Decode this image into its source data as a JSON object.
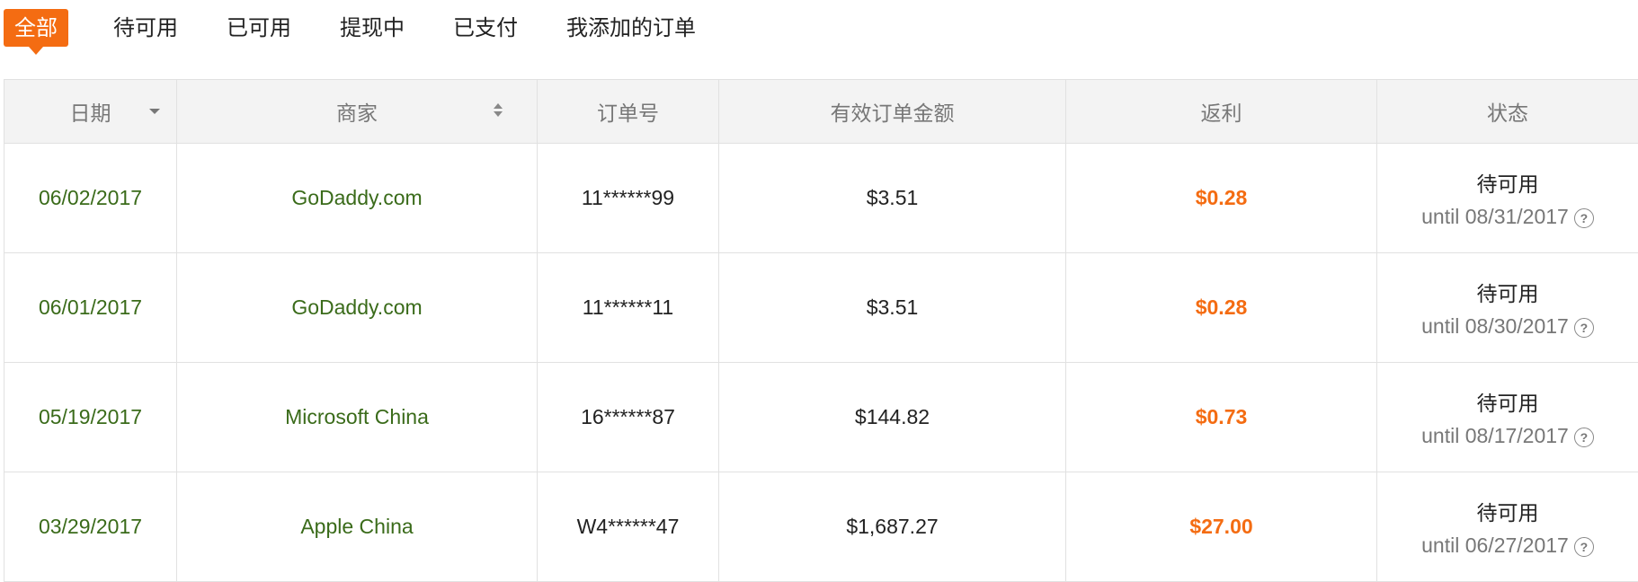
{
  "tabs": [
    {
      "label": "全部",
      "active": true
    },
    {
      "label": "待可用",
      "active": false
    },
    {
      "label": "已可用",
      "active": false
    },
    {
      "label": "提现中",
      "active": false
    },
    {
      "label": "已支付",
      "active": false
    },
    {
      "label": "我添加的订单",
      "active": false
    }
  ],
  "table": {
    "headers": {
      "date": "日期",
      "merchant": "商家",
      "order_no": "订单号",
      "amount": "有效订单金额",
      "rebate": "返利",
      "status": "状态"
    },
    "rows": [
      {
        "date": "06/02/2017",
        "merchant": "GoDaddy.com",
        "order_no": "11******99",
        "amount": "$3.51",
        "rebate": "$0.28",
        "status": "待可用",
        "until": "until 08/31/2017"
      },
      {
        "date": "06/01/2017",
        "merchant": "GoDaddy.com",
        "order_no": "11******11",
        "amount": "$3.51",
        "rebate": "$0.28",
        "status": "待可用",
        "until": "until 08/30/2017"
      },
      {
        "date": "05/19/2017",
        "merchant": "Microsoft China",
        "order_no": "16******87",
        "amount": "$144.82",
        "rebate": "$0.73",
        "status": "待可用",
        "until": "until 08/17/2017"
      },
      {
        "date": "03/29/2017",
        "merchant": "Apple China",
        "order_no": "W4******47",
        "amount": "$1,687.27",
        "rebate": "$27.00",
        "status": "待可用",
        "until": "until 06/27/2017"
      }
    ]
  },
  "icons": {
    "sort_down": "sort-desc-icon",
    "sort_both": "sort-icon",
    "help": "question-circle-icon"
  },
  "colors": {
    "accent": "#f46c12",
    "merchant_text": "#3a6b1a",
    "header_bg": "#f3f3f3"
  }
}
